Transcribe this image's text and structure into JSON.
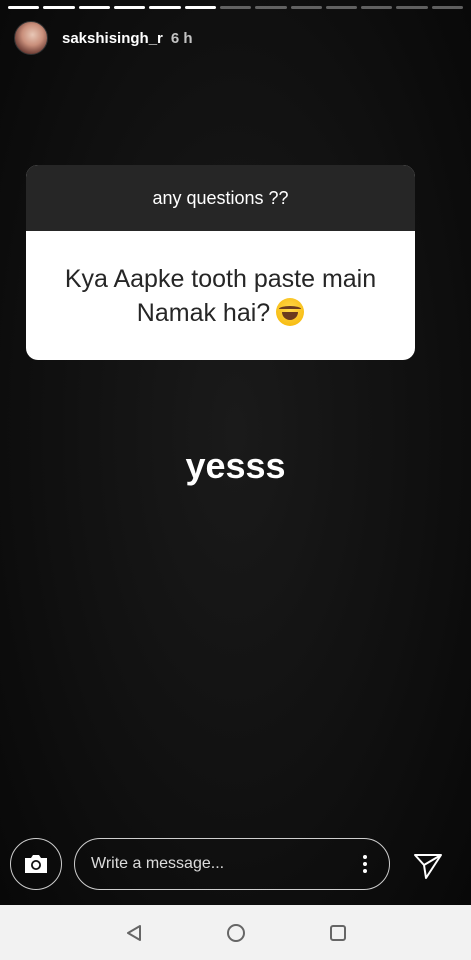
{
  "story": {
    "segments_total": 13,
    "segments_viewed": 6,
    "username": "sakshisingh_r",
    "time_ago": "6 h"
  },
  "question_sticker": {
    "prompt": "any questions ??",
    "question": "Kya Aapke tooth paste main Namak hai?",
    "emoji": "face-with-tears-of-joy"
  },
  "answer_text": "yesss",
  "reply_bar": {
    "placeholder": "Write a message..."
  },
  "icons": {
    "camera": "camera-icon",
    "more": "more-vertical-icon",
    "send": "send-icon",
    "nav_back": "back-triangle-icon",
    "nav_home": "home-circle-icon",
    "nav_recents": "recents-square-icon"
  }
}
